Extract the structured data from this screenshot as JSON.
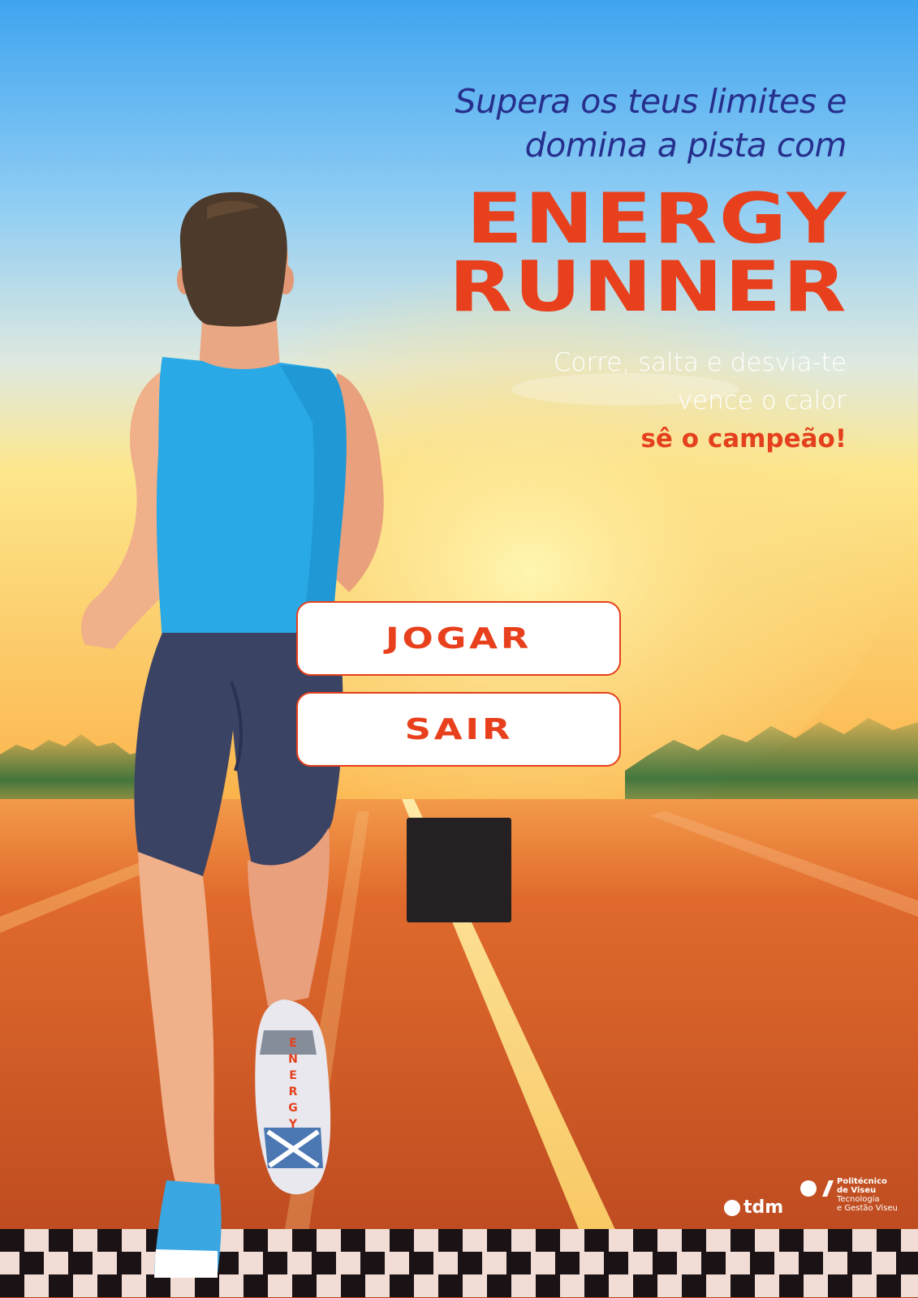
{
  "game": {
    "tagline_line1": "Supera os teus limites e",
    "tagline_line2": "domina a pista com",
    "title_line1": "ENERGY",
    "title_line2": "RUNNER",
    "subtitle_line1": "Corre, salta e desvia-te",
    "subtitle_line2": "vence o calor",
    "subtitle_line3": "sê o campeão!",
    "shoe_text": "ENERGY"
  },
  "menu": {
    "play_label": "JOGAR",
    "exit_label": "SAIR"
  },
  "logos": {
    "tdm": "tdm",
    "ipv_line1": "Politécnico",
    "ipv_line2": "de Viseu",
    "ipv_line3": "Tecnologia",
    "ipv_line4": "e Gestão Viseu"
  },
  "colors": {
    "accent": "#e8401c",
    "tagline": "#262f8c",
    "track": "#c24b20",
    "sky": "#54b4f3"
  }
}
